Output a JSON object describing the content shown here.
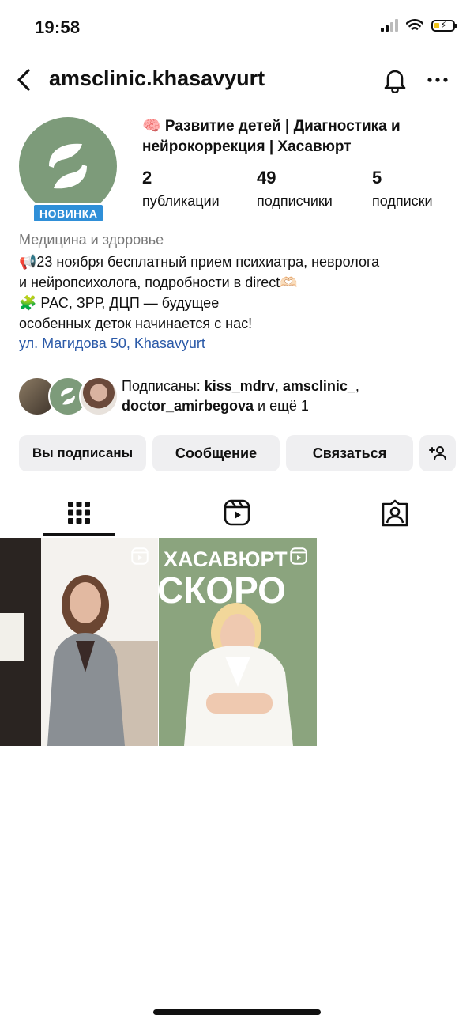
{
  "status_bar": {
    "time": "19:58"
  },
  "header": {
    "username": "amsclinic.khasavyurt",
    "back_icon": "chevron-left-icon",
    "notify_icon": "bell-icon",
    "more_icon": "more-horizontal-icon"
  },
  "profile": {
    "badge": "НОВИНКА",
    "display_name": "🧠 Развитие детей | Диагностика и нейрокоррекция | Хасавюрт",
    "stats": [
      {
        "value": "2",
        "label": "публикации"
      },
      {
        "value": "49",
        "label": "подписчики"
      },
      {
        "value": "5",
        "label": "подписки"
      }
    ],
    "category": "Медицина и здоровье",
    "bio_lines": [
      "📢23 ноября бесплатный прием психиатра, невролога",
      "и нейропсихолога, подробности в direct🫶🏻",
      "🧩 РАС, ЗРР, ДЦП — будущее",
      "особенных деток начинается с нас!"
    ],
    "location": "ул. Магидова 50, Khasavyurt"
  },
  "followed_by": {
    "prefix": "Подписаны: ",
    "user1": "kiss_mdrv",
    "sep": ", ",
    "user2": "amsclinic_",
    "sep2": ",",
    "user3": "doctor_amirbegova",
    "suffix": " и ещё 1"
  },
  "actions": {
    "following": "Вы подписаны",
    "message": "Сообщение",
    "contact": "Связаться",
    "add_user_icon": "add-person-icon"
  },
  "tabs": [
    "grid-icon",
    "reels-icon",
    "tagged-icon"
  ],
  "posts": [
    {
      "type": "reel",
      "overlay_text": []
    },
    {
      "type": "reel",
      "overlay_text": [
        "ХАСАВЮРТ",
        "СКОРО"
      ]
    }
  ],
  "colors": {
    "accent_green": "#7d9b7a",
    "badge_blue": "#2f8fd8",
    "link_blue": "#2b5aa8",
    "button_gray": "#efeff1"
  }
}
